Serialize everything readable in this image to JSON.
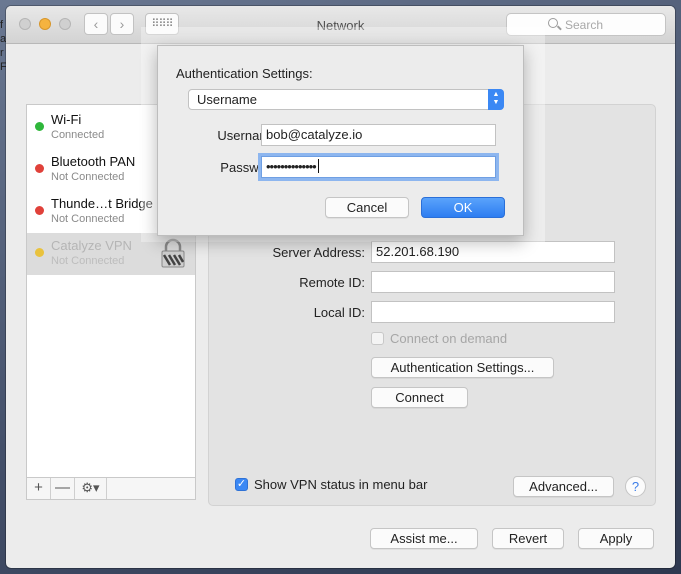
{
  "window": {
    "title": "Network",
    "search_placeholder": "Search",
    "nav_back": "‹",
    "nav_forward": "›",
    "grid_glyph": "⠿⠿⠿"
  },
  "behind": {
    "text": "f\na\nr\nFi"
  },
  "services": [
    {
      "name": "Wi-Fi",
      "status": "Connected",
      "color": "#2fb73b"
    },
    {
      "name": "Bluetooth PAN",
      "status": "Not Connected",
      "color": "#e0413a"
    },
    {
      "name": "Thunde…t Bridge",
      "status": "Not Connected",
      "color": "#e0413a"
    },
    {
      "name": "Catalyze VPN",
      "status": "Not Connected",
      "color": "#e9c23d",
      "selected": true
    }
  ],
  "list_toolbar": {
    "add": "+",
    "remove": "—",
    "gear": "⚙▾"
  },
  "detail": {
    "server_address_label": "Server Address:",
    "server_address_value": "52.201.68.190",
    "remote_id_label": "Remote ID:",
    "remote_id_value": "",
    "local_id_label": "Local ID:",
    "local_id_value": "",
    "connect_on_demand": "Connect on demand",
    "auth_settings_button": "Authentication Settings...",
    "connect_button": "Connect",
    "show_vpn_status": "Show VPN status in menu bar",
    "advanced_button": "Advanced...",
    "help": "?"
  },
  "footer": {
    "assist_button": "Assist me...",
    "revert_button": "Revert",
    "apply_button": "Apply"
  },
  "sheet": {
    "title": "Authentication Settings:",
    "method_selected": "Username",
    "username_label": "Username:",
    "username_value": "bob@catalyze.io",
    "password_label": "Password:",
    "password_value": "••••••••••••••",
    "cancel_button": "Cancel",
    "ok_button": "OK"
  }
}
